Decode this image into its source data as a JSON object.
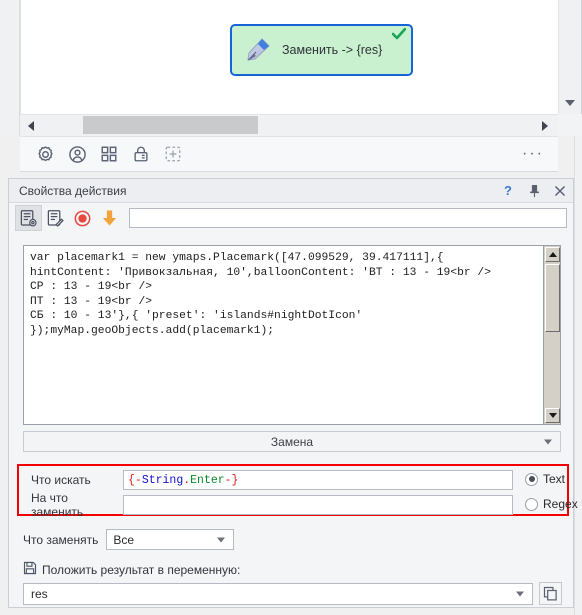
{
  "canvas": {
    "node": {
      "label": "Заменить -> {res}",
      "icon": "pen-nib-icon",
      "status_icon": "check-mark-icon",
      "fill_color": "#c9f0cf",
      "border_color": "#1565d8",
      "check_color": "#18a558"
    },
    "scroll_left_icon": "arrow-left-icon",
    "scroll_right_icon": "arrow-right-icon",
    "scroll_down_icon": "arrow-down-icon"
  },
  "icon_toolbar": {
    "items": [
      {
        "name": "settings-gear-icon",
        "label": "gear"
      },
      {
        "name": "user-account-icon",
        "label": "account"
      },
      {
        "name": "grid-apps-icon",
        "label": "apps"
      },
      {
        "name": "lock-icon",
        "label": "lock"
      },
      {
        "name": "add-plus-icon",
        "label": "add"
      }
    ],
    "overflow_label": "···"
  },
  "properties_panel": {
    "title": "Свойства действия",
    "header_buttons": [
      {
        "name": "help-button",
        "label": "?"
      },
      {
        "name": "pin-button",
        "label": "📌"
      },
      {
        "name": "close-button",
        "label": "✕"
      }
    ],
    "action_toolbar": {
      "buttons": [
        {
          "name": "action-properties-icon",
          "label": "properties",
          "selected": true
        },
        {
          "name": "action-edit-icon",
          "label": "edit",
          "selected": false
        },
        {
          "name": "record-icon",
          "label": "record",
          "selected": false
        },
        {
          "name": "insert-down-arrow-icon",
          "label": "insert",
          "selected": false
        }
      ],
      "input_value": "",
      "input_placeholder": ""
    },
    "code_editor": {
      "lines": [
        "var placemark1 = new ymaps.Placemark([47.099529, 39.417111],{",
        "hintContent: 'Привокзальная, 10',balloonContent: 'ВТ : 13 - 19<br />",
        "СР : 13 - 19<br />",
        "ПТ : 13 - 19<br />",
        "СБ : 10 - 13'},{ 'preset': 'islands#nightDotIcon'",
        "});myMap.geoObjects.add(placemark1);"
      ],
      "scroll_up_icon": "scroll-up-arrow-icon",
      "scroll_down_icon": "scroll-down-arrow-icon"
    },
    "mode_select": {
      "value": "Замена",
      "caret_icon": "chevron-down-icon"
    },
    "search_group": {
      "highlight_color": "#f40000",
      "search_label": "Что искать",
      "search_value": "{-String.Enter-}",
      "search_tokens": [
        {
          "text": "{-",
          "color": "#e01b1b"
        },
        {
          "text": "String",
          "color": "#1010cf"
        },
        {
          "text": ".",
          "color": "#e01b1b"
        },
        {
          "text": "Enter",
          "color": "#0a8a2a"
        },
        {
          "text": "-}",
          "color": "#e01b1b"
        }
      ],
      "replace_label": "На что заменить",
      "replace_value": "",
      "mode_options": [
        {
          "name": "radio-text",
          "label": "Text",
          "selected": true
        },
        {
          "name": "radio-regex",
          "label": "Regex",
          "selected": false
        }
      ]
    },
    "replace_scope": {
      "label": "Что заменять",
      "value": "Все",
      "caret_icon": "chevron-down-icon"
    },
    "result_variable": {
      "icon": "save-disk-icon",
      "label": "Положить результат в переменную:",
      "value": "res",
      "caret_icon": "chevron-down-icon",
      "copy_icon": "copy-icon"
    }
  }
}
